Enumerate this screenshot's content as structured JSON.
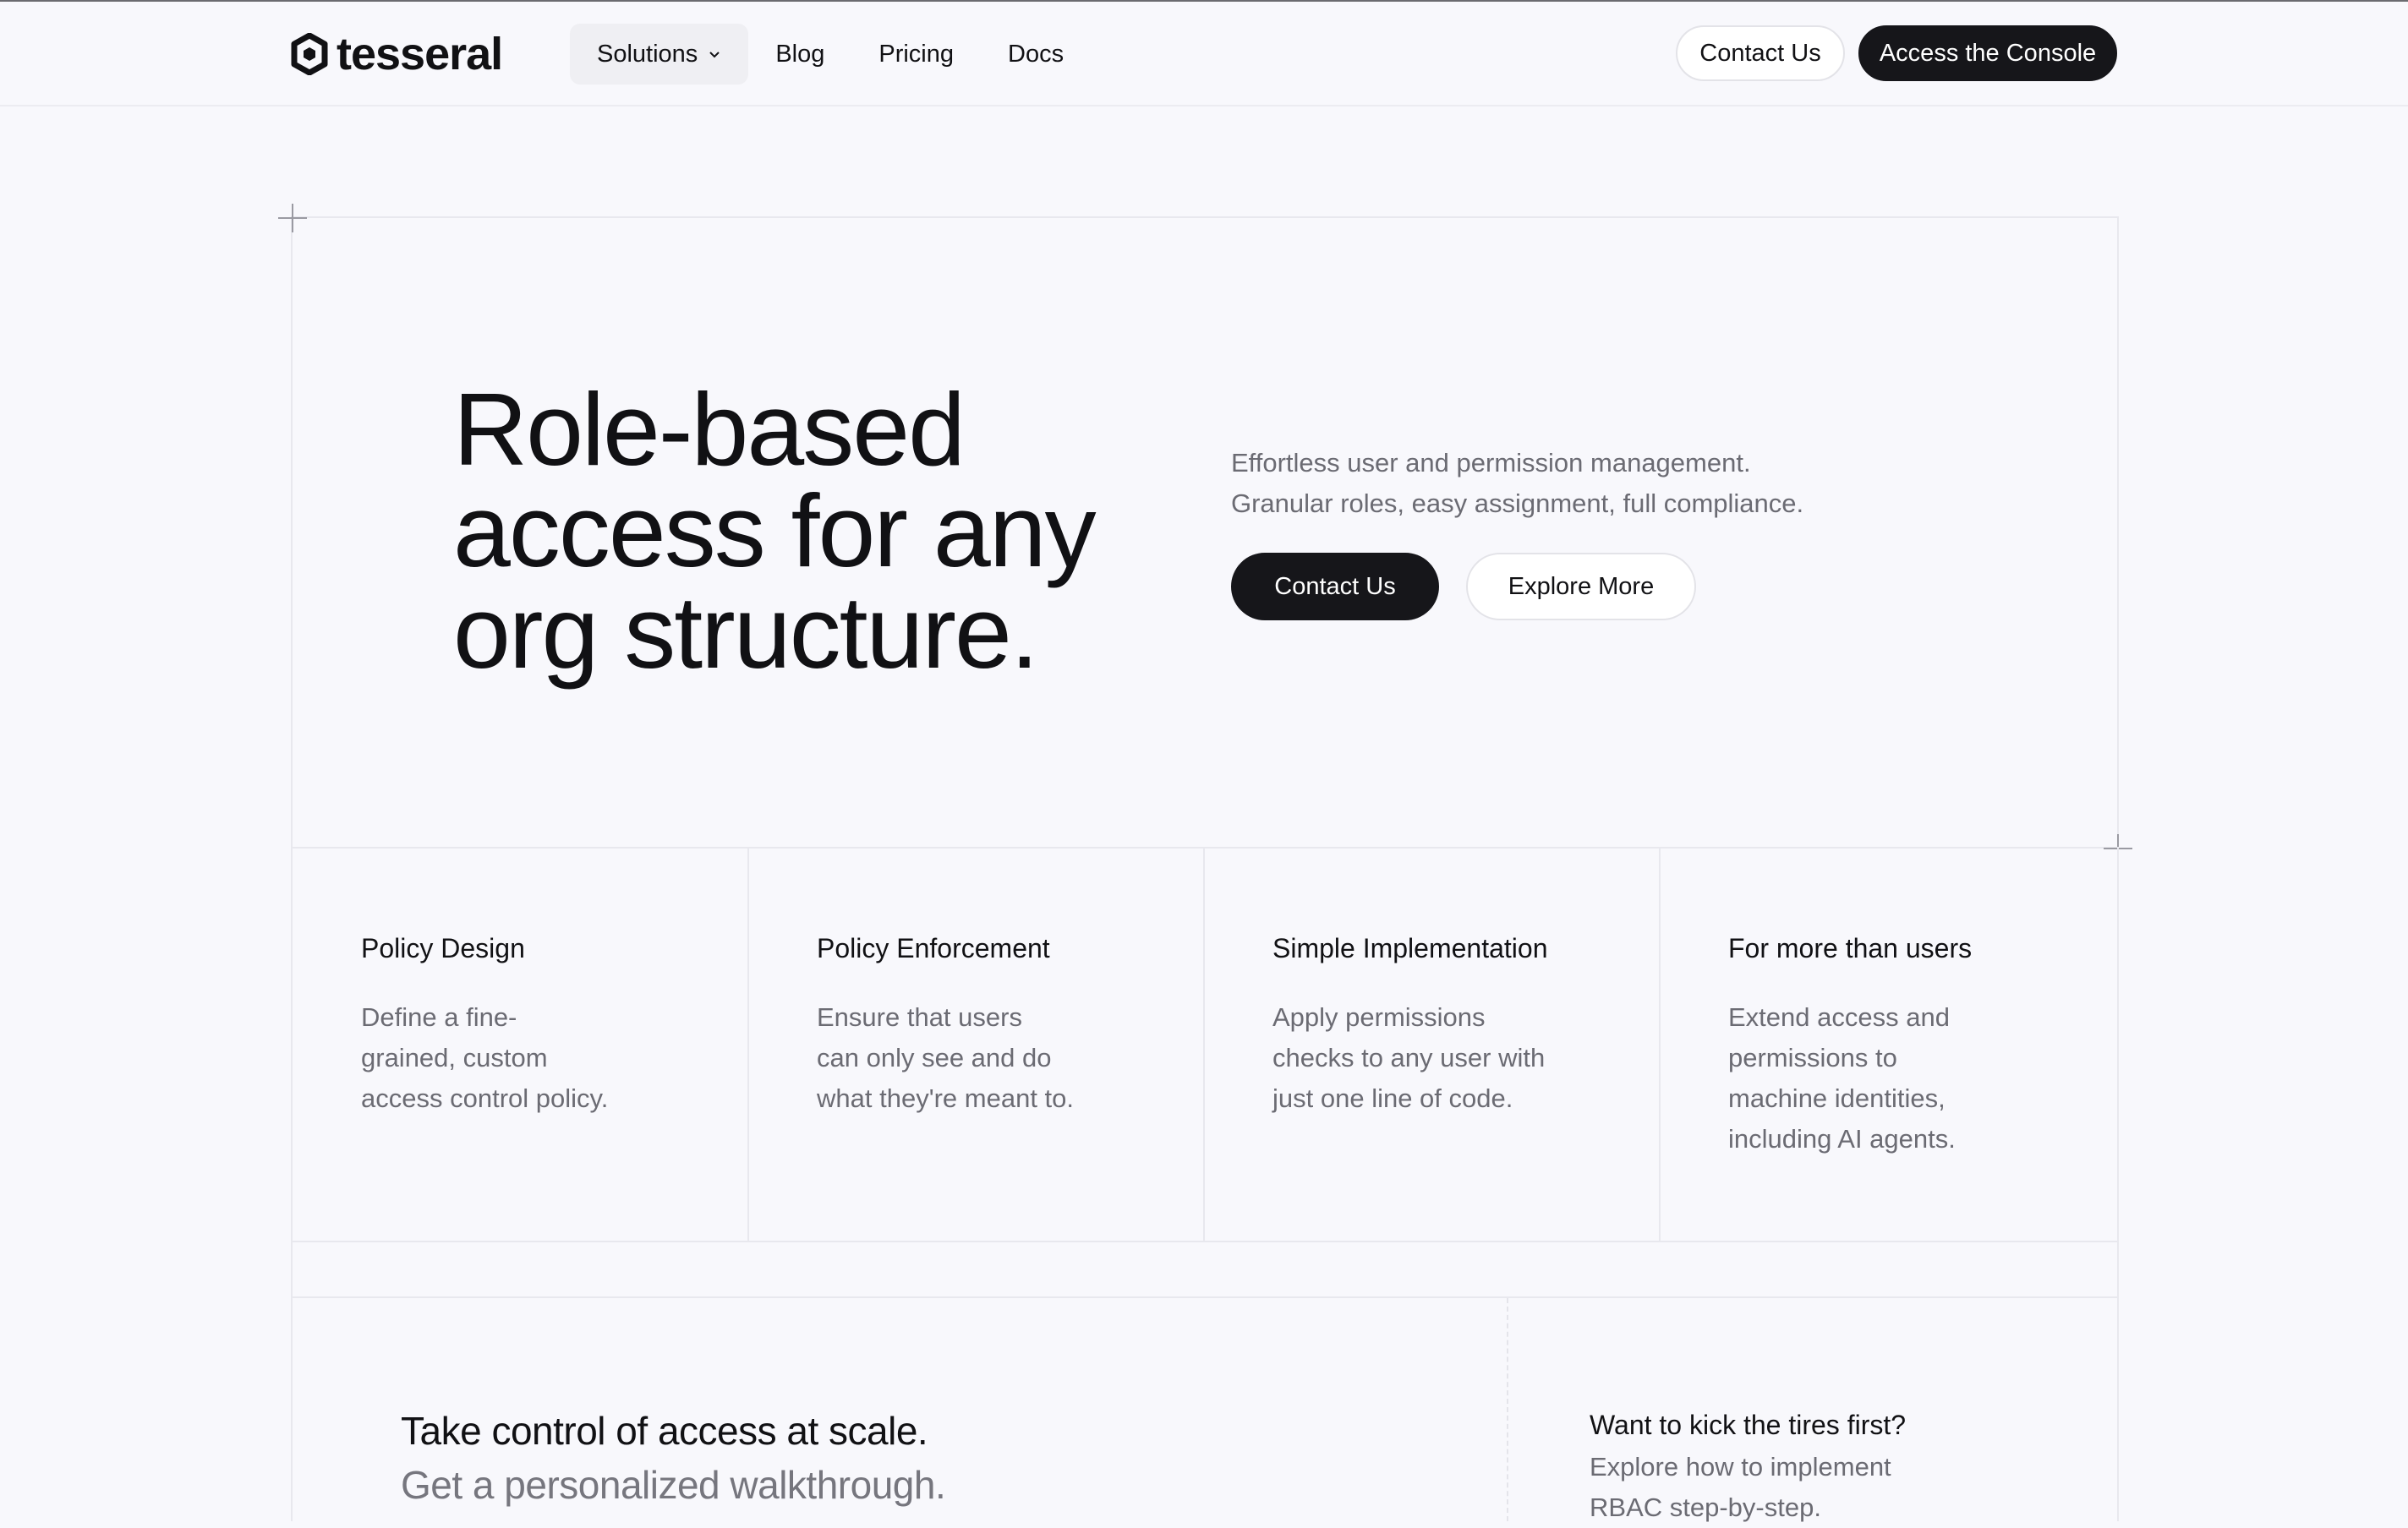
{
  "brand": {
    "name": "tesseral"
  },
  "nav": {
    "items": [
      {
        "label": "Solutions",
        "has_dropdown": true,
        "active": true
      },
      {
        "label": "Blog"
      },
      {
        "label": "Pricing"
      },
      {
        "label": "Docs"
      }
    ],
    "contact_label": "Contact Us",
    "console_label": "Access the Console"
  },
  "hero": {
    "title_lines": [
      "Role-based",
      "access for any",
      "org structure."
    ],
    "subtitle_lines": [
      "Effortless user and permission management.",
      "Granular roles, easy assignment, full compliance."
    ],
    "primary_button": "Contact Us",
    "secondary_button": "Explore More"
  },
  "features": [
    {
      "title": "Policy Design",
      "desc_lines": [
        "Define a fine-",
        "grained, custom",
        "access control policy."
      ]
    },
    {
      "title": "Policy Enforcement",
      "desc_lines": [
        "Ensure that users",
        "can only see and do",
        "what they're meant to."
      ]
    },
    {
      "title": "Simple Implementation",
      "desc_lines": [
        "Apply permissions",
        "checks to any user with",
        "just one line of code."
      ]
    },
    {
      "title": "For more than users",
      "desc_lines": [
        "Extend access and",
        "permissions to",
        "machine identities,",
        "including AI agents."
      ]
    }
  ],
  "cta": {
    "title": "Take control of access at scale.",
    "subtitle": "Get a personalized walkthrough."
  },
  "side": {
    "title": "Want to kick the tires first?",
    "desc_lines": [
      "Explore how to implement",
      "RBAC step-by-step."
    ]
  },
  "colors": {
    "background": "#f8f8fc",
    "primary": "#16161a",
    "muted_text": "#6b6b73",
    "border": "#e8e8ee"
  }
}
